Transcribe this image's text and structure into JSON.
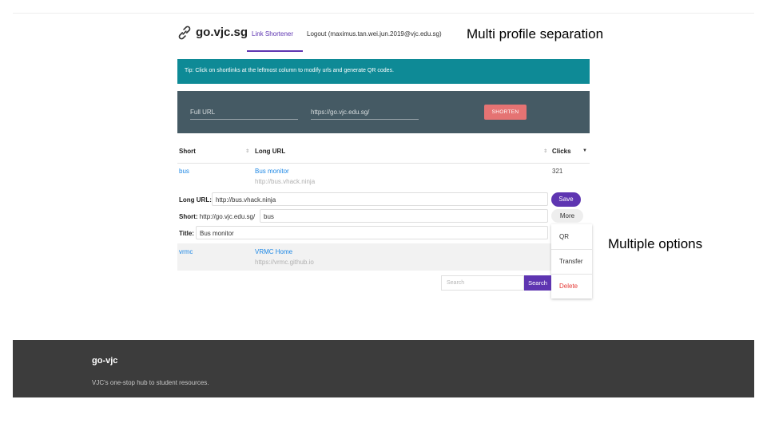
{
  "header": {
    "logo_text": "go.vjc.sg",
    "logo_icon": "link-icon",
    "tab_label": "Link Shortener",
    "logout_label": "Logout (maximus.tan.wei.jun.2019@vjc.edu.sg)",
    "accent_color": "#5e35b1"
  },
  "annotations": {
    "top": "Multi profile separation",
    "right": "Multiple options"
  },
  "tip": {
    "text": "Tip: Click on shortlinks at the leftmost column to modify urls and generate QR codes.",
    "color": "#0e8a96"
  },
  "shorten_form": {
    "full_url_placeholder": "Full URL",
    "prefix_value": "https://go.vjc.edu.sg/",
    "button_label": "SHORTEN",
    "background": "#455a64",
    "button_color": "#e57373"
  },
  "table": {
    "headers": {
      "short": "Short",
      "long": "Long URL",
      "clicks": "Clicks"
    },
    "rows": [
      {
        "short": "bus",
        "title": "Bus monitor",
        "url": "http://bus.vhack.ninja",
        "clicks": "321"
      },
      {
        "short": "vrmc",
        "title": "VRMC Home",
        "url": "https://vrmc.github.io",
        "clicks": ""
      }
    ]
  },
  "edit": {
    "long_label": "Long URL:",
    "long_value": "http://bus.vhack.ninja",
    "short_label": "Short:",
    "short_prefix": "http://go.vjc.edu.sg/",
    "short_value": "bus",
    "title_label": "Title:",
    "title_value": "Bus monitor",
    "save_label": "Save",
    "more_label": "More",
    "menu": [
      "QR",
      "Transfer",
      "Delete"
    ],
    "delete_color": "#e53935"
  },
  "search": {
    "placeholder": "Search",
    "button_label": "Search"
  },
  "footer": {
    "title": "go-vjc",
    "subtitle": "VJC's one-stop hub to student resources."
  }
}
